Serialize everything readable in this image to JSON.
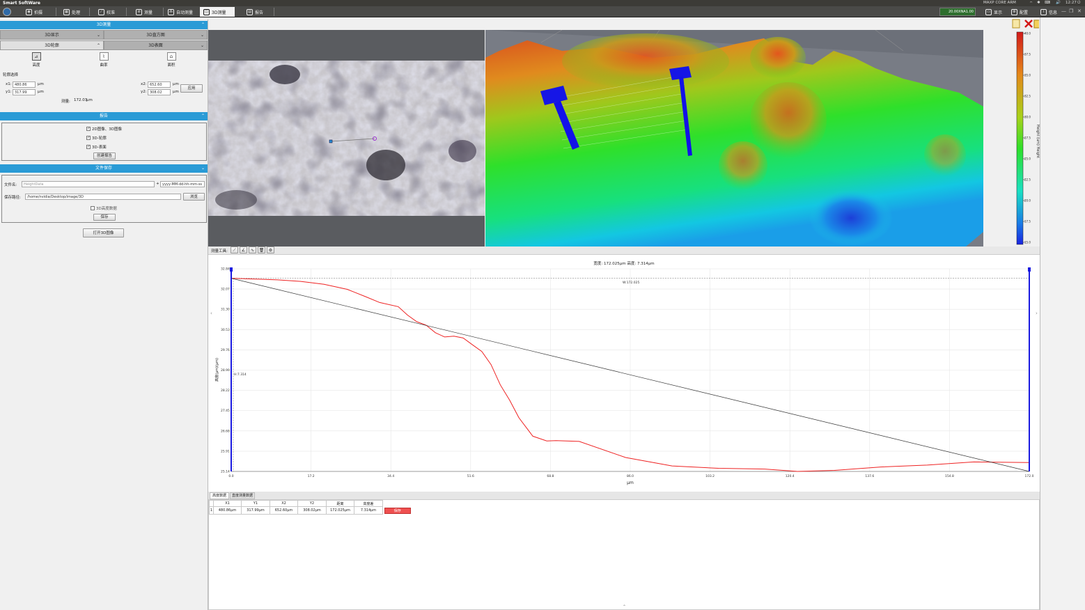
{
  "app": {
    "title": "Smart SoftWare"
  },
  "tray": {
    "gpu": "MAXP CORE ARM",
    "time": "12:27"
  },
  "nav": {
    "tabs": [
      "拍摄",
      "处理",
      "校准",
      "测量",
      "自动测量",
      "3D测量",
      "报告"
    ],
    "active": "3D测量",
    "right": {
      "lens": "20.00XNA1.00",
      "display": "显示",
      "config": "配置",
      "info": "信息"
    }
  },
  "left": {
    "section_3d": "3D测量",
    "subtabs": [
      "3D显示",
      "3D直方图",
      "3D轮廓",
      "3D表面"
    ],
    "tools": [
      "高度",
      "曲率",
      "面积"
    ],
    "profile_select": "轮廓选择",
    "x1_label": "x1:",
    "x1": "480.86",
    "y1_label": "y1:",
    "y1": "317.99",
    "x2_label": "x2:",
    "x2": "652.60",
    "y2_label": "y2:",
    "y2": "308.02",
    "unit": "μm",
    "apply": "应用",
    "measure_label": "测量:",
    "measure_value": "172.03",
    "section_report": "报告",
    "report_checks": [
      "2D图像、3D图像",
      "3D-轮廓",
      "3D-表面"
    ],
    "create_report": "创建报告",
    "section_save": "文件保存",
    "filename_label": "文件名:",
    "filename_placeholder": "HeightData",
    "plus": "+",
    "date_format": "yyyy-MM-dd-hh-mm-ss",
    "path_label": "保存路径:",
    "path": "/home/nvidia/Desktop/image/3D",
    "browse": "浏览",
    "save_3d_height": "3D高度数据",
    "save": "保存",
    "open_3d": "打开3D图像"
  },
  "colorbar": {
    "label": "Height (um) Height",
    "ticks": [
      "40.0",
      "37.5",
      "35.0",
      "32.5",
      "30.0",
      "27.5",
      "25.0",
      "22.5",
      "20.0",
      "17.5",
      "15.0"
    ]
  },
  "toolbar": {
    "label": "测量工具:"
  },
  "chart_data": {
    "type": "line",
    "title": "宽度: 172.025μm 高度: 7.314μm",
    "xlabel": "μm",
    "ylabel": "高度(μm)(μm)",
    "xlim": [
      0,
      172.0
    ],
    "ylim": [
      25.14,
      32.84
    ],
    "x_ticks": [
      "0.0",
      "17.2",
      "34.4",
      "51.6",
      "68.8",
      "86.0",
      "103.2",
      "120.4",
      "137.6",
      "154.8",
      "172.0"
    ],
    "y_ticks": [
      "32.84",
      "32.07",
      "31.30",
      "30.53",
      "29.76",
      "28.99",
      "28.22",
      "27.45",
      "26.68",
      "25.91",
      "25.14"
    ],
    "annot_w": "W:172.025",
    "annot_h": "H:7.314",
    "series": [
      {
        "color": "#ee2222",
        "x": [
          0,
          5,
          10,
          15,
          20,
          25,
          29,
          32,
          36,
          38,
          40,
          42,
          44,
          46,
          48,
          50,
          52,
          54,
          56,
          58,
          60,
          62,
          65,
          68,
          70,
          75,
          85,
          95,
          105,
          115,
          122,
          130,
          140,
          150,
          160,
          172
        ],
        "y": [
          32.48,
          32.45,
          32.42,
          32.36,
          32.25,
          32.06,
          31.78,
          31.56,
          31.4,
          31.08,
          30.83,
          30.7,
          30.41,
          30.25,
          30.28,
          30.21,
          29.95,
          29.7,
          29.2,
          28.43,
          27.85,
          27.18,
          26.48,
          26.3,
          26.31,
          26.28,
          25.67,
          25.35,
          25.26,
          25.23,
          25.14,
          25.18,
          25.31,
          25.38,
          25.5,
          25.48
        ]
      },
      {
        "color": "#333333",
        "x": [
          0,
          172
        ],
        "y": [
          32.48,
          25.14
        ]
      }
    ]
  },
  "bottom": {
    "tabs": [
      "高度数据",
      "直度测量数据"
    ],
    "columns": [
      "X1",
      "Y1",
      "X2",
      "Y2",
      "距离",
      "高度差"
    ],
    "rows": [
      [
        "480.86μm",
        "317.99μm",
        "652.60μm",
        "308.02μm",
        "172.025μm",
        "7.314μm"
      ]
    ],
    "row_index": "1",
    "save": "保存"
  }
}
